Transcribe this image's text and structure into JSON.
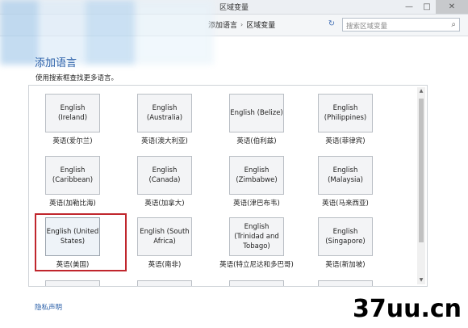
{
  "window": {
    "title": "区域变量",
    "minimize_glyph": "—",
    "maximize_glyph": "□",
    "close_glyph": "✕"
  },
  "address": {
    "crumbs": [
      "添加语言",
      "区域变量"
    ],
    "separator": "›",
    "refresh_icon": "↻",
    "search_placeholder": "搜索区域变量",
    "search_icon": "⌕"
  },
  "page": {
    "heading": "添加语言",
    "subtitle": "使用搜索框查找更多语言。",
    "privacy_link": "隐私声明"
  },
  "languages": [
    {
      "name": "English (Ireland)",
      "label": "英语(爱尔兰)"
    },
    {
      "name": "English (Australia)",
      "label": "英语(澳大利亚)"
    },
    {
      "name": "English (Belize)",
      "label": "英语(伯利兹)"
    },
    {
      "name": "English (Philippines)",
      "label": "英语(菲律宾)"
    },
    {
      "name": "English (Caribbean)",
      "label": "英语(加勒比海)"
    },
    {
      "name": "English (Canada)",
      "label": "英语(加拿大)"
    },
    {
      "name": "English (Zimbabwe)",
      "label": "英语(津巴布韦)"
    },
    {
      "name": "English (Malaysia)",
      "label": "英语(马来西亚)"
    },
    {
      "name": "English (United States)",
      "label": "英语(美国)",
      "selected": true
    },
    {
      "name": "English (South Africa)",
      "label": "英语(南非)"
    },
    {
      "name": "English (Trinidad and Tobago)",
      "label": "英语(特立尼达和多巴哥)"
    },
    {
      "name": "English (Singapore)",
      "label": "英语(新加坡)"
    }
  ],
  "scrollbar": {
    "up_glyph": "▲",
    "down_glyph": "▼"
  },
  "watermark": "37uu.cn",
  "colors": {
    "heading": "#2a5fa8",
    "selection": "#c0262d"
  }
}
